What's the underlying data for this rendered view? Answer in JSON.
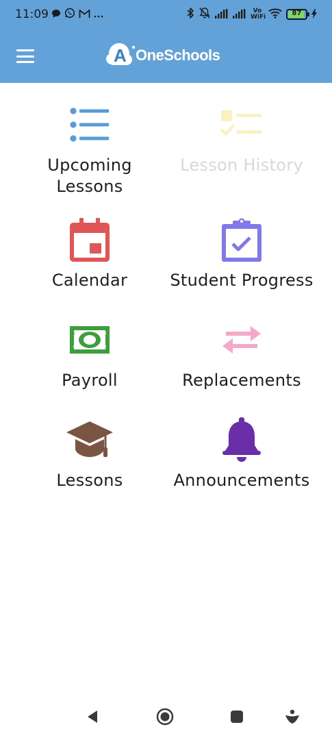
{
  "status_bar": {
    "time": "11:09",
    "battery_level": "87",
    "network_label": "Vo WiFi"
  },
  "header": {
    "app_name": "OneSchools",
    "logo_letter": "A",
    "background_color": "#62A2D8"
  },
  "menu": {
    "items": [
      {
        "label": "Upcoming\nLessons",
        "icon": "list-icon",
        "color": "#5B9BD5",
        "enabled": true
      },
      {
        "label": "Lesson History",
        "icon": "checklist-icon",
        "color": "#FCEFC4",
        "enabled": false
      },
      {
        "label": "Calendar",
        "icon": "calendar-icon",
        "color": "#E05555",
        "enabled": true
      },
      {
        "label": "Student Progress",
        "icon": "clipboard-check-icon",
        "color": "#7F7AE8",
        "enabled": true
      },
      {
        "label": "Payroll",
        "icon": "money-icon",
        "color": "#3E9E3E",
        "enabled": true
      },
      {
        "label": "Replacements",
        "icon": "swap-arrows-icon",
        "color": "#F3A9C8",
        "enabled": true
      },
      {
        "label": "Lessons",
        "icon": "graduation-cap-icon",
        "color": "#7B5544",
        "enabled": true
      },
      {
        "label": "Announcements",
        "icon": "bell-icon",
        "color": "#6A2EA8",
        "enabled": true
      }
    ]
  },
  "nav_bar": {
    "buttons": [
      "back-icon",
      "home-icon",
      "recents-icon",
      "assistant-icon"
    ]
  }
}
